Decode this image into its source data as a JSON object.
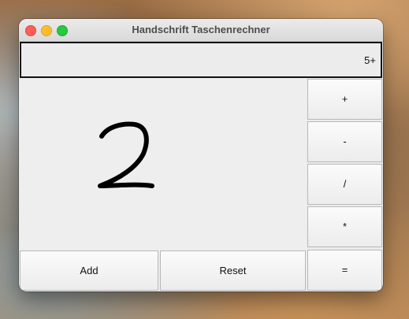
{
  "window": {
    "title": "Handschrift Taschenrechner"
  },
  "display": {
    "value": "5+"
  },
  "canvas": {
    "handwritten_digit": "2"
  },
  "operators": {
    "plus": "+",
    "minus": "-",
    "divide": "/",
    "multiply": "*",
    "equals": "="
  },
  "actions": {
    "add": "Add",
    "reset": "Reset"
  },
  "colors": {
    "close": "#ff5f57",
    "minimize": "#febc2e",
    "maximize": "#28c840",
    "ink": "#000000"
  }
}
